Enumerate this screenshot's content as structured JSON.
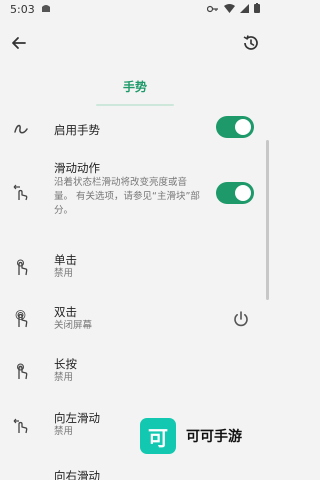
{
  "status_bar": {
    "time": "5:03"
  },
  "header": {
    "tab_title": "手势"
  },
  "settings": {
    "enable_gestures": {
      "title": "启用手势",
      "enabled": true
    },
    "swipe_action": {
      "title": "滑动动作",
      "description": "沿着状态栏滑动将改变亮度或音量。 有关选项，请参见“主滑块”部分。",
      "enabled": true
    },
    "single_tap": {
      "title": "单击",
      "value": "禁用"
    },
    "double_tap": {
      "title": "双击",
      "value": "关闭屏幕"
    },
    "long_press": {
      "title": "长按",
      "value": "禁用"
    },
    "swipe_left": {
      "title": "向左滑动",
      "value": "禁用"
    },
    "swipe_right": {
      "title": "向右滑动"
    }
  },
  "watermark": {
    "logo_text": "可",
    "text": "可可手游"
  },
  "colors": {
    "accent": "#1e9a6a",
    "watermark": "#13c8b0"
  }
}
